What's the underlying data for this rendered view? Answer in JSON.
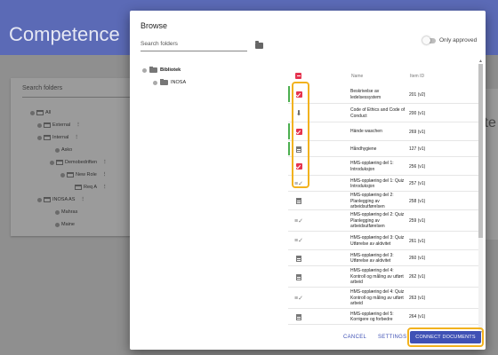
{
  "app": {
    "title": "Competence",
    "right_partial_text": "ite"
  },
  "bg_tree": {
    "search_placeholder": "Search folders",
    "nodes": [
      "All",
      "External",
      "Internal",
      "Asko",
      "Demobedriften",
      "New Role",
      "Req A",
      "INOSA AS",
      "Mahras",
      "Maine"
    ]
  },
  "dialog": {
    "title": "Browse",
    "folder_search_placeholder": "Search folders",
    "toggle_label": "Only approved",
    "tree": [
      {
        "label": "Bibliotek"
      },
      {
        "label": "INOSA"
      }
    ],
    "table": {
      "col_name": "Name",
      "col_id": "Item ID",
      "rows": [
        {
          "icon": "checkbox-checked",
          "name": "Beskrivelse av ledelsessystem",
          "id": "201 (v2)",
          "bar": "#4caf50"
        },
        {
          "icon": "download-icon",
          "name": "Code of Ethics and Code of Conduct",
          "id": "200 (v1)",
          "bar": ""
        },
        {
          "icon": "checkbox-checked",
          "name": "Hände waschen",
          "id": "269 (v1)",
          "bar": "#4caf50"
        },
        {
          "icon": "document-icon",
          "name": "Håndhygiene",
          "id": "127 (v1)",
          "bar": "#4caf50"
        },
        {
          "icon": "checkbox-checked",
          "name": "HMS-opplæring del 1: Introduksjon",
          "id": "256 (v1)",
          "bar": ""
        },
        {
          "icon": "quiz-icon",
          "name": "HMS-opplæring del 1: Quiz Introduksjon",
          "id": "257 (v1)",
          "bar": ""
        },
        {
          "icon": "document-icon",
          "name": "HMS-opplæring del 2: Planlegging av arbeidsutførelsen",
          "id": "258 (v1)",
          "bar": ""
        },
        {
          "icon": "quiz-icon",
          "name": "HMS-opplæring del 2: Quiz Planlegging av arbeidsutførelsen",
          "id": "259 (v1)",
          "bar": ""
        },
        {
          "icon": "quiz-icon",
          "name": "HMS-opplæring del 3: Quiz Utførelse av aktivitet",
          "id": "261 (v1)",
          "bar": ""
        },
        {
          "icon": "document-icon",
          "name": "HMS-opplæring del 3: Utførelse av aktivitet",
          "id": "260 (v1)",
          "bar": ""
        },
        {
          "icon": "document-icon",
          "name": "HMS-opplæring del 4: Kontroll og måling av utført arbeid",
          "id": "262 (v1)",
          "bar": ""
        },
        {
          "icon": "quiz-icon",
          "name": "HMS-opplæring del 4: Quiz Kontroll og måling av utført arbeid",
          "id": "263 (v1)",
          "bar": ""
        },
        {
          "icon": "document-icon",
          "name": "HMS-opplæring del 5: Korrigere og forbedre",
          "id": "264 (v1)",
          "bar": ""
        }
      ]
    },
    "actions": {
      "cancel": "CANCEL",
      "settings": "SETTINGS",
      "connect": "CONNECT DOCUMENTS"
    },
    "colors": {
      "accent": "#3f51b5",
      "check": "#e5344f",
      "highlight": "#f2b21e",
      "approved_bar": "#4caf50"
    }
  }
}
